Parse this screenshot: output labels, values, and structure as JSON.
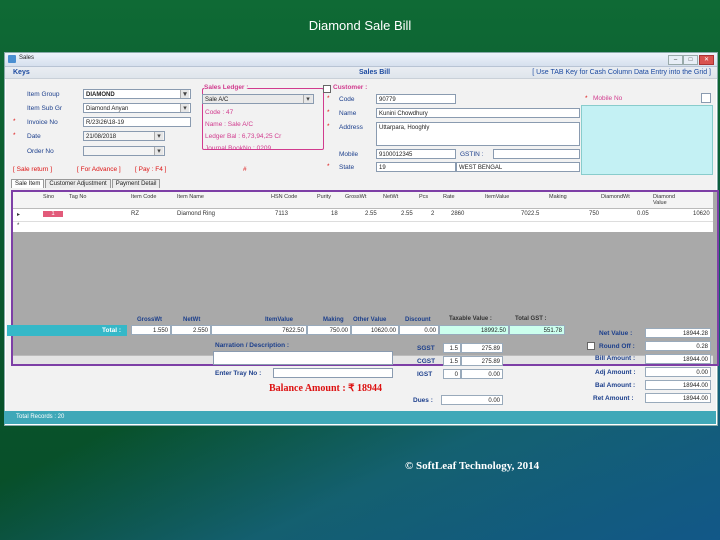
{
  "slide": {
    "title": "Diamond Sale Bill",
    "footer": "© SoftLeaf Technology, 2014"
  },
  "window": {
    "title": "Sales",
    "min": "–",
    "max": "□",
    "close": "✕"
  },
  "keys": {
    "label": "Keys",
    "section": "Sales Bill",
    "hint": "[ Use TAB Key for Cash Column Data Entry into the Grid ]"
  },
  "left": {
    "item_group_label": "Item Group",
    "item_group": "DIAMOND",
    "item_sub_gr_label": "Item Sub Gr",
    "item_sub_gr": "Diamond Anyan",
    "invoice_no_label": "Invoice No",
    "invoice_no": "R/23\\26\\18-19",
    "date_label": "Date",
    "date": "21/08/2018",
    "order_no_label": "Order No",
    "order_no": ""
  },
  "ledger": {
    "header": "Sales Ledger :",
    "value": "Sale A/C",
    "code": "Code : 47",
    "name": "Name : Sale A/C",
    "bal": "Ledger Bal : 6,73,94,25 Cr",
    "journal": "Journal BookNo : 0209"
  },
  "customer": {
    "header": "Customer :",
    "code_label": "Code",
    "code": "90779",
    "name_label": "Name",
    "name": "Kunini Chowdhury",
    "address_label": "Address",
    "address": "Uttarpara, Hooghly",
    "mobile_label": "Mobile",
    "mobile": "9100012345",
    "gstin_label": "GSTIN :",
    "gstin": "",
    "state_label": "State",
    "state_code": "19",
    "state": "WEST BENGAL",
    "mobile_no_label": "Mobile No"
  },
  "hints": {
    "sale_return": "[ Sale return ]",
    "full_adv": "[ For Advance ]",
    "pay": "[ Pay : F4 ]",
    "hash": "#"
  },
  "tabs": [
    "Sale Item",
    "Customer Adjustment",
    "Payment Detail"
  ],
  "grid": {
    "headers": [
      "Sino",
      "Tag No",
      "Item Code",
      "Item Name",
      "HSN Code",
      "Purity",
      "GrossWt",
      "NetWt",
      "Pcs",
      "Rate",
      "ItemValue",
      "Making",
      "DiamondWt",
      "Diamond Value"
    ],
    "rows": [
      [
        "1",
        "",
        "RZ",
        "Diamond Ring",
        "7113",
        "18",
        "2.55",
        "2.55",
        "2",
        "2860",
        "7022.5",
        "750",
        "0.05",
        "10620"
      ]
    ]
  },
  "totals": {
    "label": "Total :",
    "headers": [
      "GrossWt",
      "NetWt",
      "ItemValue",
      "Making",
      "Other Value",
      "Discount",
      "Taxable Value :",
      "Total GST :"
    ],
    "values": [
      "1.550",
      "2.550",
      "7622.50",
      "750.00",
      "10620.00",
      "0.00",
      "18992.50",
      "551.78"
    ]
  },
  "narration_label": "Narration / Description :",
  "tray_label": "Enter Tray No :",
  "balance": "Balance Amount : ₹ 18944",
  "gst": {
    "sgst_label": "SGST",
    "sgst_rate": "1.5",
    "sgst": "275.89",
    "cgst_label": "CGST",
    "cgst_rate": "1.5",
    "cgst": "275.89",
    "igst_label": "IGST",
    "igst_rate": "0",
    "igst": "0.00",
    "dues_label": "Dues :",
    "dues": "0.00"
  },
  "right": {
    "net_value_label": "Net Value :",
    "net_value": "18944.28",
    "round_off_label": "Round Off :",
    "round_off": "0.28",
    "bill_amount_label": "Bill Amount :",
    "bill_amount": "18944.00",
    "adj_amount_label": "Adj Amount :",
    "adj_amount": "0.00",
    "bal_amount_label": "Bal Amount :",
    "bal_amount": "18944.00",
    "ret_amount_label": "Ret Amount :",
    "ret_amount": "18944.00"
  },
  "status": {
    "records": "Total Records : 20"
  }
}
